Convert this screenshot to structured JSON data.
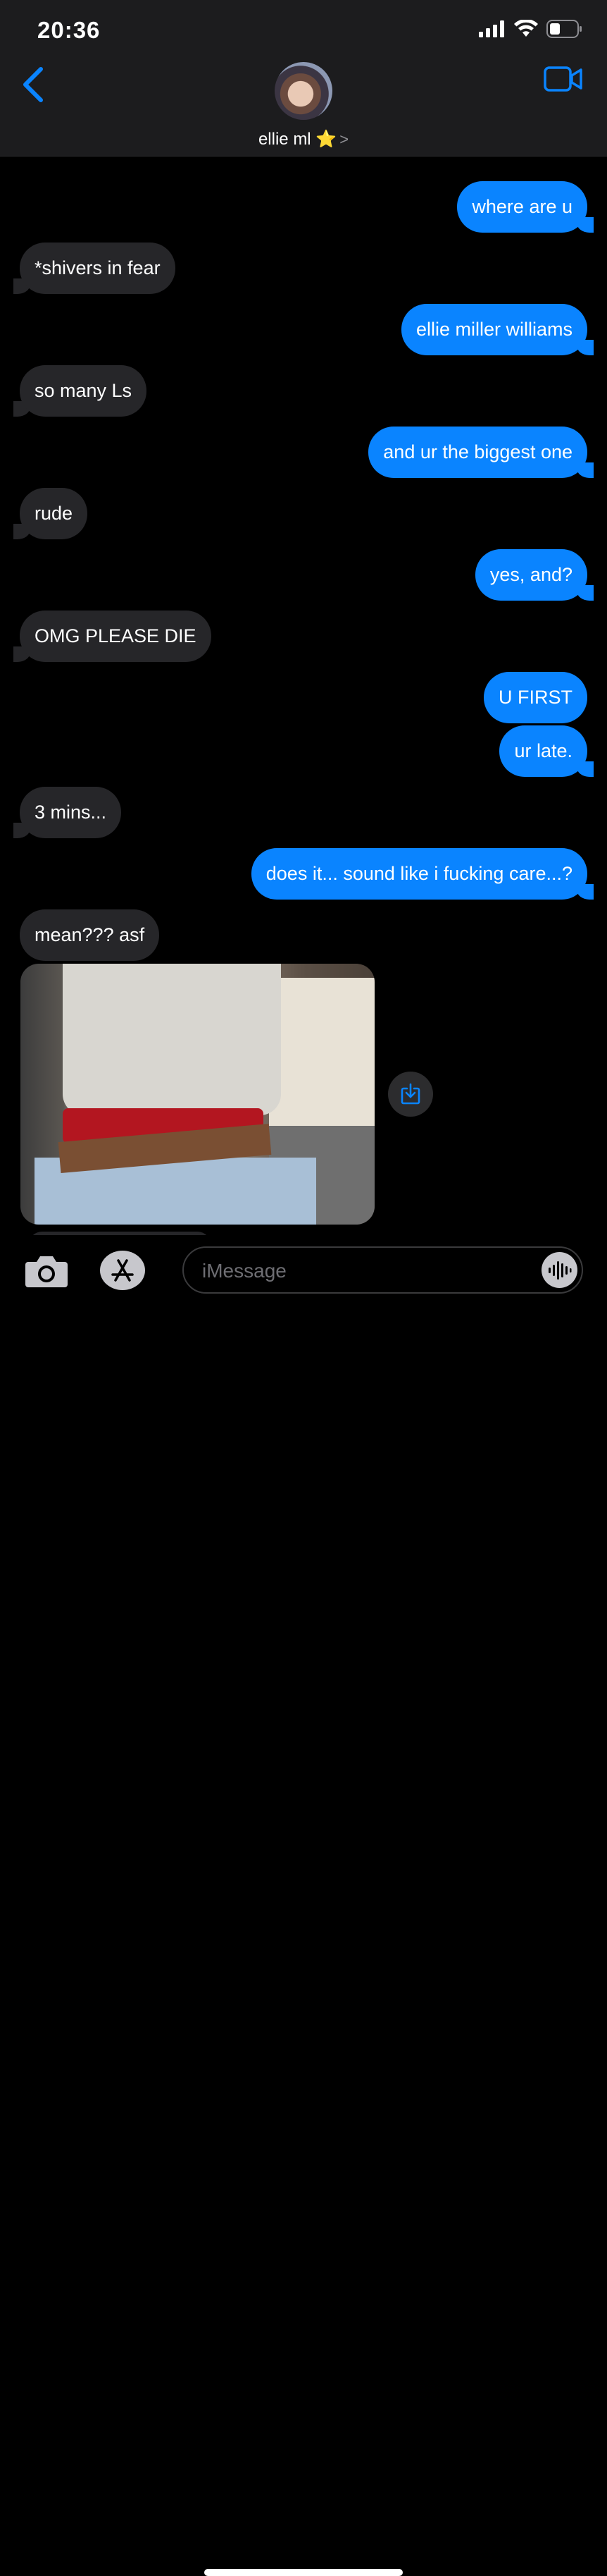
{
  "status_bar": {
    "time": "20:36",
    "icons": [
      "signal-icon",
      "wifi-icon",
      "battery-icon"
    ]
  },
  "header": {
    "back_icon": "chevron-left-icon",
    "contact_name": "ellie ml ⭐️",
    "contact_chevron": ">",
    "video_icon": "video-camera-icon"
  },
  "messages": [
    {
      "side": "sent",
      "text": "where are u"
    },
    {
      "side": "received",
      "text": "*shivers in fear"
    },
    {
      "side": "sent",
      "text": "ellie miller williams"
    },
    {
      "side": "received",
      "text": "so many Ls"
    },
    {
      "side": "sent",
      "text": "and ur the biggest one"
    },
    {
      "side": "received",
      "text": "rude"
    },
    {
      "side": "sent",
      "text": "yes, and?"
    },
    {
      "side": "received",
      "text": "OMG PLEASE DIE"
    },
    {
      "side": "sent",
      "text": "U FIRST"
    },
    {
      "side": "sent",
      "text": "ur late."
    },
    {
      "side": "received",
      "text": "3 mins..."
    },
    {
      "side": "sent",
      "text": "does it... sound like i fucking care...?"
    },
    {
      "side": "received",
      "text": "mean??? asf"
    }
  ],
  "attachment": {
    "type": "photo",
    "save_icon": "save-download-icon"
  },
  "input_bar": {
    "camera_icon": "camera-icon",
    "apps_icon": "app-store-icon",
    "placeholder": "iMessage",
    "audio_icon": "waveform-icon"
  },
  "colors": {
    "sent_bubble": "#0a84ff",
    "received_bubble": "#262629",
    "accent": "#0a84ff",
    "background": "#000000"
  }
}
